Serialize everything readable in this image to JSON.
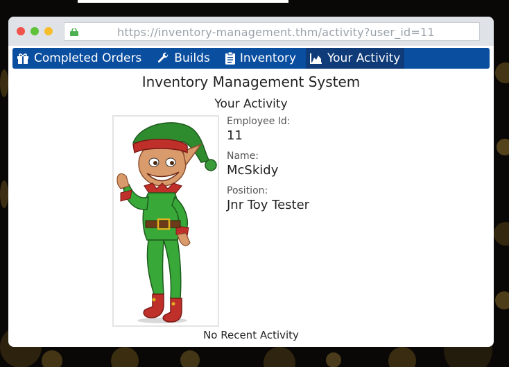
{
  "browser": {
    "url": "https://inventory-management.thm/activity?user_id=11",
    "icons": [
      "lock-icon",
      "close-dot",
      "minimize-dot",
      "zoom-dot"
    ]
  },
  "nav": {
    "items": [
      {
        "label": "Completed Orders",
        "icon": "gift-icon"
      },
      {
        "label": "Builds",
        "icon": "wrench-icon"
      },
      {
        "label": "Inventory",
        "icon": "clipboard-icon"
      },
      {
        "label": "Your Activity",
        "icon": "chart-area-icon",
        "active": true
      }
    ]
  },
  "page": {
    "title": "Inventory Management System",
    "section": "Your Activity"
  },
  "employee": {
    "id_label": "Employee Id:",
    "id": "11",
    "name_label": "Name:",
    "name": "McSkidy",
    "position_label": "Position:",
    "position": "Jnr Toy Tester"
  },
  "activity": {
    "message": "No Recent Activity"
  },
  "colors": {
    "nav_bg": "#0a4ea0",
    "nav_active": "#0f3b78",
    "chrome_bg": "#dfe3e8",
    "lock": "#4caf50"
  }
}
